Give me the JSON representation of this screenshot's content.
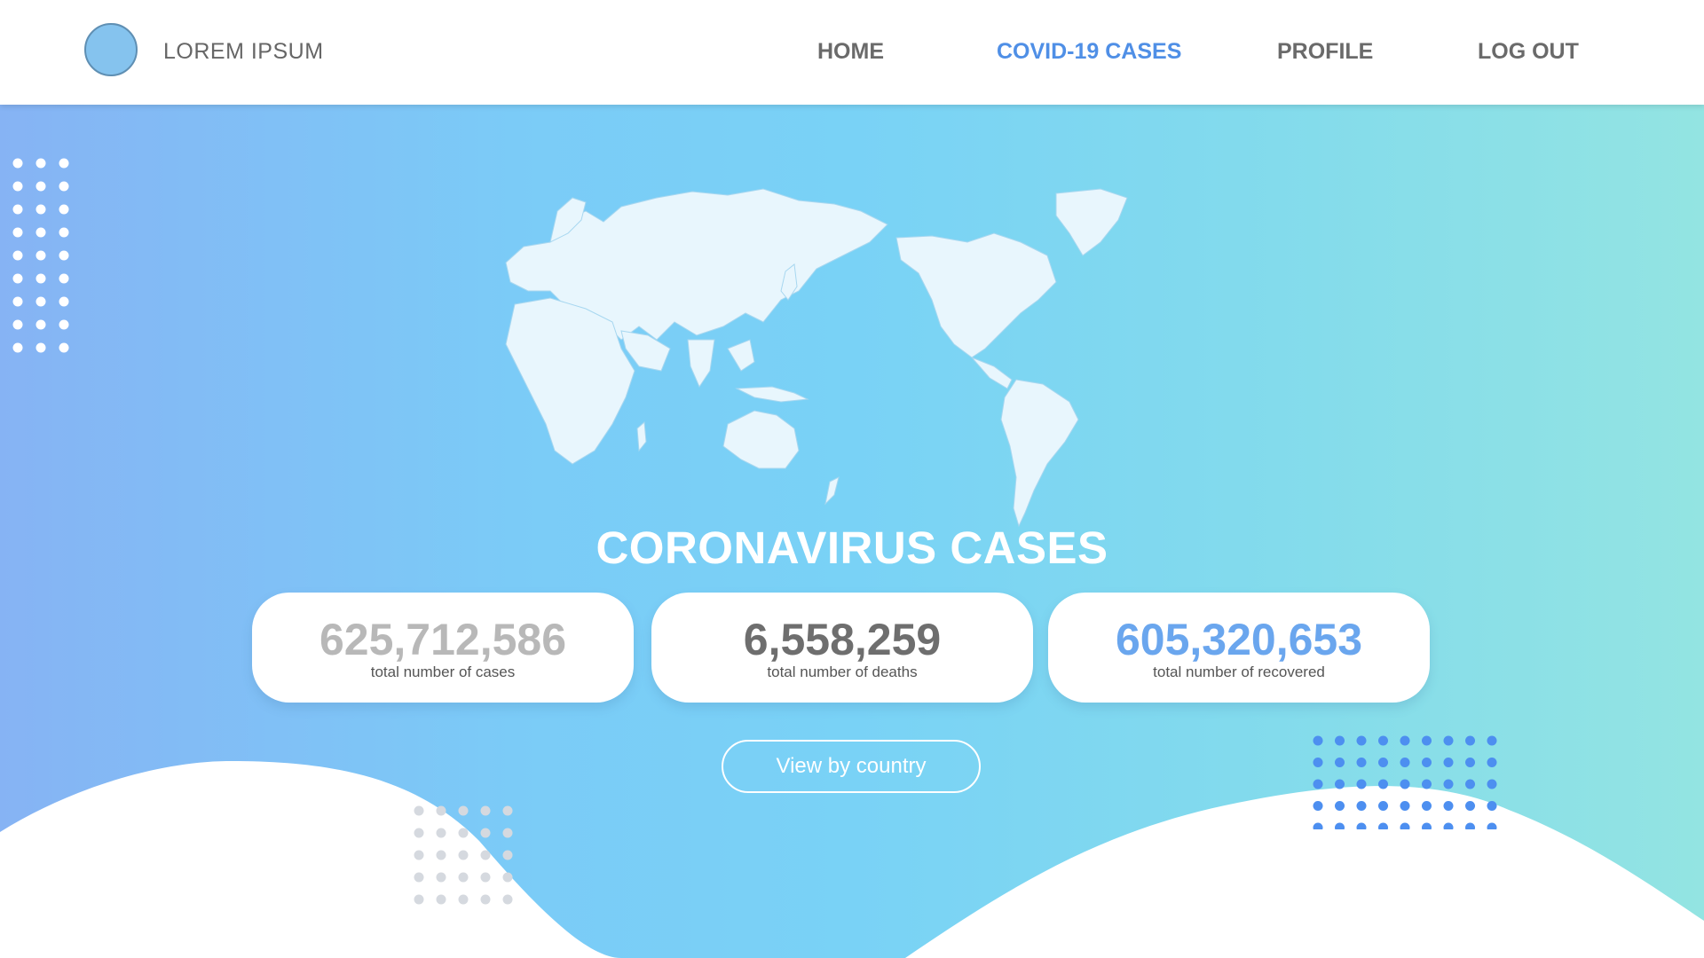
{
  "header": {
    "brand": "LOREM IPSUM",
    "nav": [
      {
        "label": "HOME",
        "active": false
      },
      {
        "label": "COVID-19 CASES",
        "active": true
      },
      {
        "label": "PROFILE",
        "active": false
      },
      {
        "label": "LOG OUT",
        "active": false
      }
    ]
  },
  "hero": {
    "title": "CORONAVIRUS CASES",
    "stats": [
      {
        "value": "625,712,586",
        "label": "total number of cases",
        "color": "#b8b8b8"
      },
      {
        "value": "6,558,259",
        "label": "total number of deaths",
        "color": "#6e6e6e"
      },
      {
        "value": "605,320,653",
        "label": "total number of recovered",
        "color": "#6aa6ee"
      }
    ],
    "country_button": "View by country"
  },
  "colors": {
    "accent": "#4f8fe6",
    "gradient_start": "#86b3f4",
    "gradient_end": "#93e4e2",
    "logo": "#85c3ee"
  },
  "icons": {
    "logo": "circle-logo-icon",
    "map": "world-map-icon"
  }
}
